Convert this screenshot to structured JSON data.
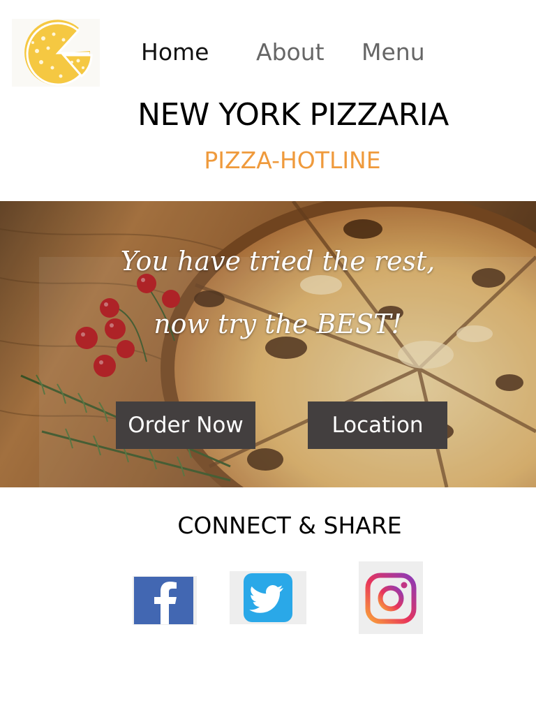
{
  "nav": {
    "logo_icon": "pizza-slice-logo-icon",
    "items": [
      {
        "label": "Home"
      },
      {
        "label": "About"
      },
      {
        "label": "Menu"
      }
    ]
  },
  "header": {
    "title": "NEW YORK PIZZARIA",
    "hotline": "PIZZA-HOTLINE"
  },
  "hero": {
    "line1": "You have tried the rest,",
    "line2": "now try the BEST!",
    "buttons": {
      "order_label": "Order Now",
      "location_label": "Location"
    }
  },
  "connect": {
    "heading": "CONNECT & SHARE",
    "icons": [
      "facebook-icon",
      "twitter-icon",
      "instagram-icon"
    ]
  },
  "colors": {
    "accent_orange": "#ef9a3c",
    "logo_yellow": "#f5c842",
    "button_dark": "#433f3f",
    "facebook_blue": "#4267b2",
    "twitter_blue": "#2aa8e8"
  }
}
